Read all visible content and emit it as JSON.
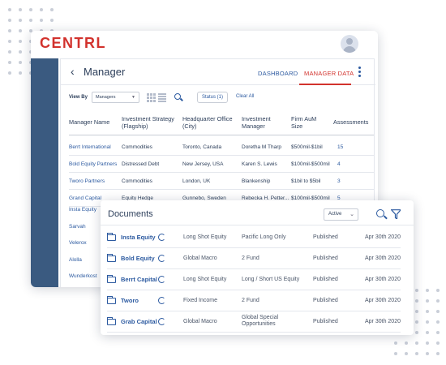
{
  "app": {
    "logo": "CENTRL"
  },
  "manager": {
    "back": "‹",
    "title": "Manager",
    "tabs": [
      {
        "label": "DASHBOARD",
        "active": false
      },
      {
        "label": "MANAGER DATA",
        "active": true
      }
    ],
    "toolbar": {
      "view_by_label": "View By",
      "view_by_value": "Managers",
      "status_label": "Status (1)",
      "clear_all": "Clear All"
    },
    "columns": [
      [
        "Manager Name"
      ],
      [
        "Investment Strategy",
        "(Flagship)"
      ],
      [
        "Headquarter Office",
        "(City)"
      ],
      [
        "Investment",
        "Manager"
      ],
      [
        "Firm AuM",
        "Size"
      ],
      [
        "Assessments"
      ]
    ],
    "rows": [
      [
        "Berrt International",
        "Commodities",
        "Toronto, Canada",
        "Doretha M Tharp",
        "$500mil-$1bil",
        "15"
      ],
      [
        "Bold Equity Partners",
        "Distressed Debt",
        "New Jersey, USA",
        "Karen S. Lewis",
        "$100mil-$500mil",
        "4"
      ],
      [
        "Tworo Partners",
        "Commodities",
        "London, UK",
        "Blankenship",
        "$1bil to $5bil",
        "3"
      ],
      [
        "Grand Capital",
        "Equity Hedge",
        "Gunnebo, Sweden",
        "Rebecka H. Petter...",
        "$100mil-$500mil",
        "5"
      ]
    ],
    "more_names": [
      "Insta Equity",
      "Sarvah",
      "Velerox",
      "Alolla",
      "Wunderkost"
    ]
  },
  "documents": {
    "title": "Documents",
    "filter_value": "Active",
    "rows": [
      {
        "name": "Insta Equity",
        "strategy": "Long Shot Equity",
        "fund": "Pacific Long Only",
        "status": "Published",
        "date": "Apr 30th 2020"
      },
      {
        "name": "Bold Equity",
        "strategy": "Global Macro",
        "fund": "2 Fund",
        "status": "Published",
        "date": "Apr 30th 2020"
      },
      {
        "name": "Berrt Capital",
        "strategy": "Long Shot Equity",
        "fund": "Long / Short US Equity",
        "status": "Published",
        "date": "Apr 30th 2020"
      },
      {
        "name": "Tworo",
        "strategy": "Fixed Income",
        "fund": "2 Fund",
        "status": "Published",
        "date": "Apr 30th 2020"
      },
      {
        "name": "Grab Capital",
        "strategy": "Global Macro",
        "fund": "Global Special Opportunities",
        "status": "Published",
        "date": "Apr 30th 2020"
      }
    ]
  },
  "colors": {
    "accent": "#2c5aa0",
    "brand_red": "#d2322d",
    "sidebar": "#3a5a80"
  }
}
